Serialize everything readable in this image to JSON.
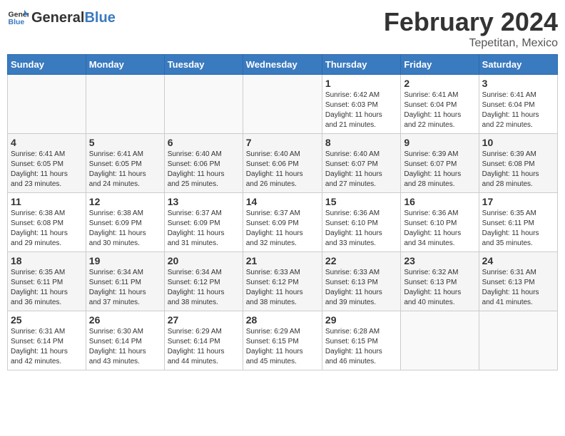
{
  "header": {
    "logo_general": "General",
    "logo_blue": "Blue",
    "title": "February 2024",
    "subtitle": "Tepetitan, Mexico"
  },
  "weekdays": [
    "Sunday",
    "Monday",
    "Tuesday",
    "Wednesday",
    "Thursday",
    "Friday",
    "Saturday"
  ],
  "weeks": [
    [
      {
        "day": "",
        "info": ""
      },
      {
        "day": "",
        "info": ""
      },
      {
        "day": "",
        "info": ""
      },
      {
        "day": "",
        "info": ""
      },
      {
        "day": "1",
        "info": "Sunrise: 6:42 AM\nSunset: 6:03 PM\nDaylight: 11 hours\nand 21 minutes."
      },
      {
        "day": "2",
        "info": "Sunrise: 6:41 AM\nSunset: 6:04 PM\nDaylight: 11 hours\nand 22 minutes."
      },
      {
        "day": "3",
        "info": "Sunrise: 6:41 AM\nSunset: 6:04 PM\nDaylight: 11 hours\nand 22 minutes."
      }
    ],
    [
      {
        "day": "4",
        "info": "Sunrise: 6:41 AM\nSunset: 6:05 PM\nDaylight: 11 hours\nand 23 minutes."
      },
      {
        "day": "5",
        "info": "Sunrise: 6:41 AM\nSunset: 6:05 PM\nDaylight: 11 hours\nand 24 minutes."
      },
      {
        "day": "6",
        "info": "Sunrise: 6:40 AM\nSunset: 6:06 PM\nDaylight: 11 hours\nand 25 minutes."
      },
      {
        "day": "7",
        "info": "Sunrise: 6:40 AM\nSunset: 6:06 PM\nDaylight: 11 hours\nand 26 minutes."
      },
      {
        "day": "8",
        "info": "Sunrise: 6:40 AM\nSunset: 6:07 PM\nDaylight: 11 hours\nand 27 minutes."
      },
      {
        "day": "9",
        "info": "Sunrise: 6:39 AM\nSunset: 6:07 PM\nDaylight: 11 hours\nand 28 minutes."
      },
      {
        "day": "10",
        "info": "Sunrise: 6:39 AM\nSunset: 6:08 PM\nDaylight: 11 hours\nand 28 minutes."
      }
    ],
    [
      {
        "day": "11",
        "info": "Sunrise: 6:38 AM\nSunset: 6:08 PM\nDaylight: 11 hours\nand 29 minutes."
      },
      {
        "day": "12",
        "info": "Sunrise: 6:38 AM\nSunset: 6:09 PM\nDaylight: 11 hours\nand 30 minutes."
      },
      {
        "day": "13",
        "info": "Sunrise: 6:37 AM\nSunset: 6:09 PM\nDaylight: 11 hours\nand 31 minutes."
      },
      {
        "day": "14",
        "info": "Sunrise: 6:37 AM\nSunset: 6:09 PM\nDaylight: 11 hours\nand 32 minutes."
      },
      {
        "day": "15",
        "info": "Sunrise: 6:36 AM\nSunset: 6:10 PM\nDaylight: 11 hours\nand 33 minutes."
      },
      {
        "day": "16",
        "info": "Sunrise: 6:36 AM\nSunset: 6:10 PM\nDaylight: 11 hours\nand 34 minutes."
      },
      {
        "day": "17",
        "info": "Sunrise: 6:35 AM\nSunset: 6:11 PM\nDaylight: 11 hours\nand 35 minutes."
      }
    ],
    [
      {
        "day": "18",
        "info": "Sunrise: 6:35 AM\nSunset: 6:11 PM\nDaylight: 11 hours\nand 36 minutes."
      },
      {
        "day": "19",
        "info": "Sunrise: 6:34 AM\nSunset: 6:11 PM\nDaylight: 11 hours\nand 37 minutes."
      },
      {
        "day": "20",
        "info": "Sunrise: 6:34 AM\nSunset: 6:12 PM\nDaylight: 11 hours\nand 38 minutes."
      },
      {
        "day": "21",
        "info": "Sunrise: 6:33 AM\nSunset: 6:12 PM\nDaylight: 11 hours\nand 38 minutes."
      },
      {
        "day": "22",
        "info": "Sunrise: 6:33 AM\nSunset: 6:13 PM\nDaylight: 11 hours\nand 39 minutes."
      },
      {
        "day": "23",
        "info": "Sunrise: 6:32 AM\nSunset: 6:13 PM\nDaylight: 11 hours\nand 40 minutes."
      },
      {
        "day": "24",
        "info": "Sunrise: 6:31 AM\nSunset: 6:13 PM\nDaylight: 11 hours\nand 41 minutes."
      }
    ],
    [
      {
        "day": "25",
        "info": "Sunrise: 6:31 AM\nSunset: 6:14 PM\nDaylight: 11 hours\nand 42 minutes."
      },
      {
        "day": "26",
        "info": "Sunrise: 6:30 AM\nSunset: 6:14 PM\nDaylight: 11 hours\nand 43 minutes."
      },
      {
        "day": "27",
        "info": "Sunrise: 6:29 AM\nSunset: 6:14 PM\nDaylight: 11 hours\nand 44 minutes."
      },
      {
        "day": "28",
        "info": "Sunrise: 6:29 AM\nSunset: 6:15 PM\nDaylight: 11 hours\nand 45 minutes."
      },
      {
        "day": "29",
        "info": "Sunrise: 6:28 AM\nSunset: 6:15 PM\nDaylight: 11 hours\nand 46 minutes."
      },
      {
        "day": "",
        "info": ""
      },
      {
        "day": "",
        "info": ""
      }
    ]
  ]
}
